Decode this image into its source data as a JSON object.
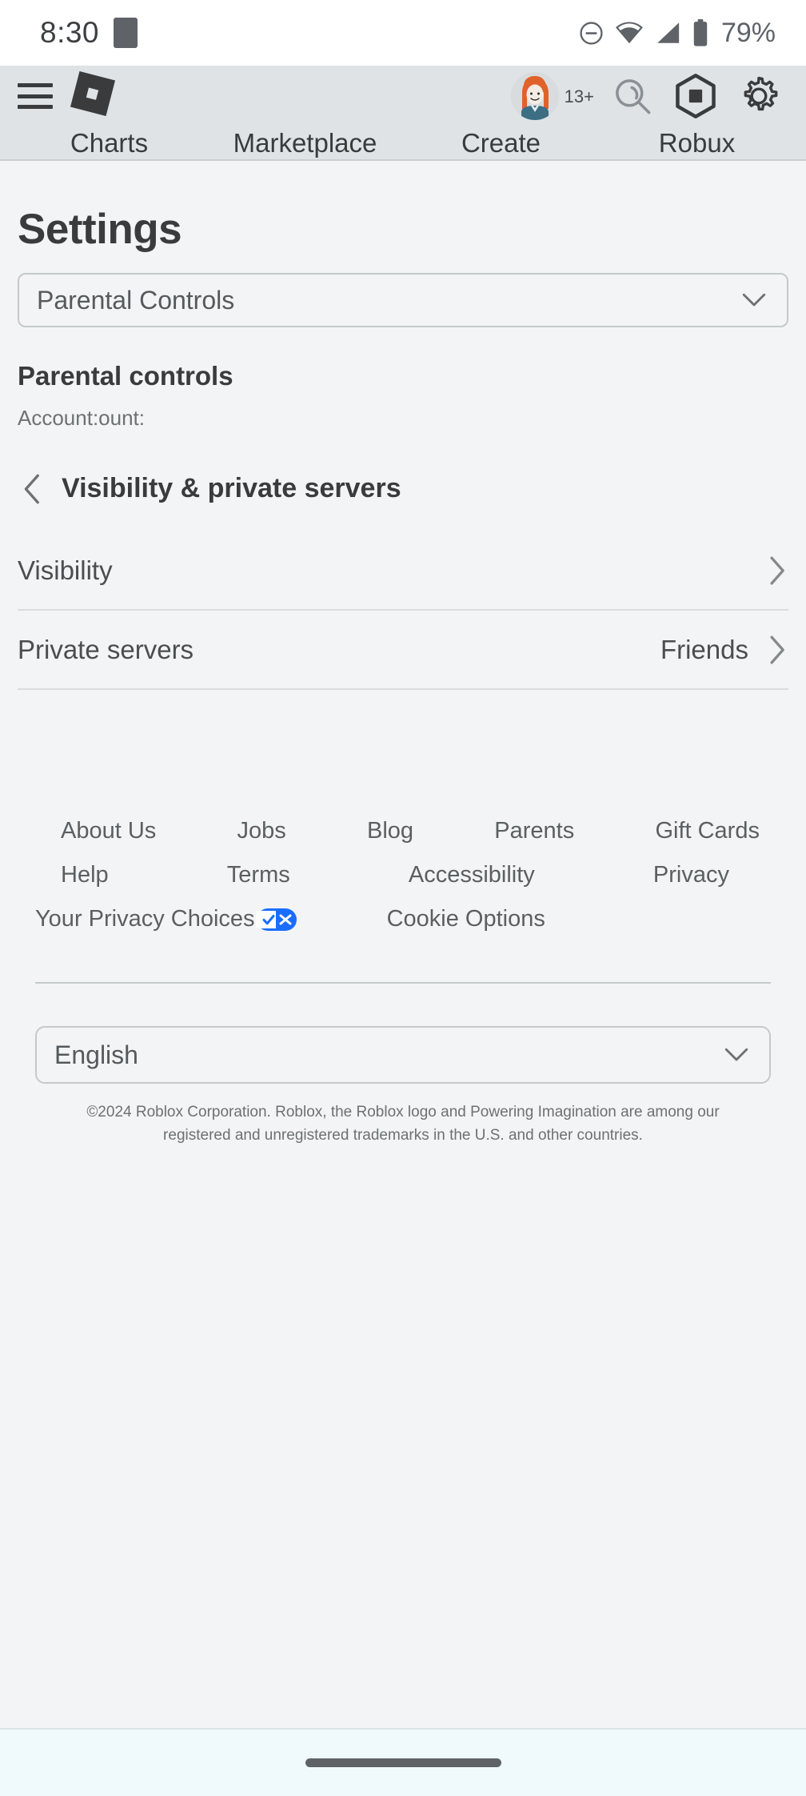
{
  "status_bar": {
    "time": "8:30",
    "battery_percent": "79%",
    "icons": [
      "app-indicator",
      "do-not-disturb-icon",
      "wifi-icon",
      "signal-icon",
      "battery-icon"
    ]
  },
  "header": {
    "menu_icon": "hamburger-menu-icon",
    "logo": "roblox-logo-icon",
    "age_badge": "13+",
    "icons": [
      "avatar",
      "search-icon",
      "robux-icon",
      "gear-icon"
    ],
    "nav_tabs": [
      {
        "label": "Charts"
      },
      {
        "label": "Marketplace"
      },
      {
        "label": "Create"
      },
      {
        "label": "Robux"
      }
    ]
  },
  "main": {
    "page_title": "Settings",
    "category_select": {
      "value": "Parental Controls",
      "chevron": "chevron-down-icon"
    },
    "section_title": "Parental controls",
    "account_line": "Account:ount:",
    "sub_header": {
      "back_icon": "chevron-left-icon",
      "title": "Visibility & private servers"
    },
    "rows": [
      {
        "label": "Visibility",
        "value": "",
        "chevron": "chevron-right-icon"
      },
      {
        "label": "Private servers",
        "value": "Friends",
        "chevron": "chevron-right-icon"
      }
    ]
  },
  "footer": {
    "row1": [
      {
        "label": "About Us"
      },
      {
        "label": "Jobs"
      },
      {
        "label": "Blog"
      },
      {
        "label": "Parents"
      },
      {
        "label": "Gift Cards"
      }
    ],
    "row2": [
      {
        "label": "Help"
      },
      {
        "label": "Terms"
      },
      {
        "label": "Accessibility"
      },
      {
        "label": "Privacy"
      }
    ],
    "row3": [
      {
        "label": "Your Privacy Choices",
        "icon": "privacy-choices-icon"
      },
      {
        "label": "Cookie Options"
      }
    ],
    "language_select": {
      "value": "English",
      "chevron": "chevron-down-icon"
    },
    "copyright": "©2024 Roblox Corporation. Roblox, the Roblox logo and Powering Imagination are among our registered and unregistered trademarks in the U.S. and other countries."
  },
  "colors": {
    "header_bg": "#dfe3e5",
    "page_bg": "#f2f4f5",
    "text_primary": "#393b3d",
    "text_secondary": "#5b5f62",
    "privacy_blue": "#1a6dff",
    "nav_bar_bg": "#f0fafc"
  }
}
